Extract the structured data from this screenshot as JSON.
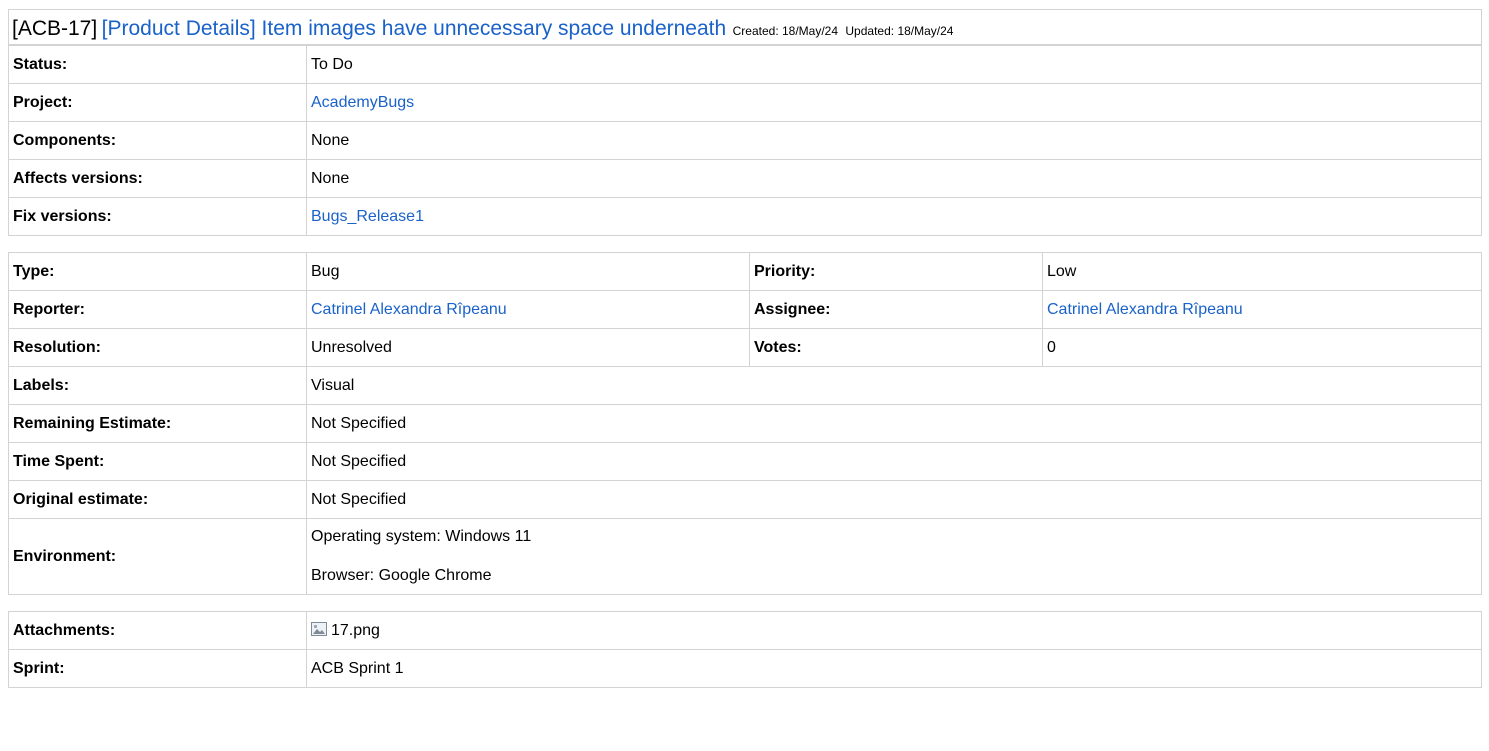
{
  "issue": {
    "key": "[ACB-17]",
    "summary": "[Product Details] Item images have unnecessary space underneath",
    "created_label": "Created:",
    "created": "18/May/24",
    "updated_label": "Updated:",
    "updated": "18/May/24"
  },
  "details": {
    "status_label": "Status:",
    "status": "To Do",
    "project_label": "Project:",
    "project": "AcademyBugs",
    "components_label": "Components:",
    "components": "None",
    "affects_label": "Affects versions:",
    "affects": "None",
    "fix_label": "Fix versions:",
    "fix": "Bugs_Release1"
  },
  "people": {
    "type_label": "Type:",
    "type": "Bug",
    "priority_label": "Priority:",
    "priority": "Low",
    "reporter_label": "Reporter:",
    "reporter": "Catrinel Alexandra Rîpeanu",
    "assignee_label": "Assignee:",
    "assignee": "Catrinel Alexandra Rîpeanu",
    "resolution_label": "Resolution:",
    "resolution": "Unresolved",
    "votes_label": "Votes:",
    "votes": "0",
    "labels_label": "Labels:",
    "labels": "Visual",
    "remaining_label": "Remaining Estimate:",
    "remaining": "Not Specified",
    "spent_label": "Time Spent:",
    "spent": "Not Specified",
    "original_label": "Original estimate:",
    "original": "Not Specified",
    "environment_label": "Environment:",
    "environment_line1": "Operating system: Windows 11",
    "environment_line2": "Browser: Google Chrome"
  },
  "extra": {
    "attachments_label": "Attachments:",
    "attachment_icon": "image-icon",
    "attachment_file": "17.png",
    "sprint_label": "Sprint:",
    "sprint": "ACB Sprint 1"
  }
}
